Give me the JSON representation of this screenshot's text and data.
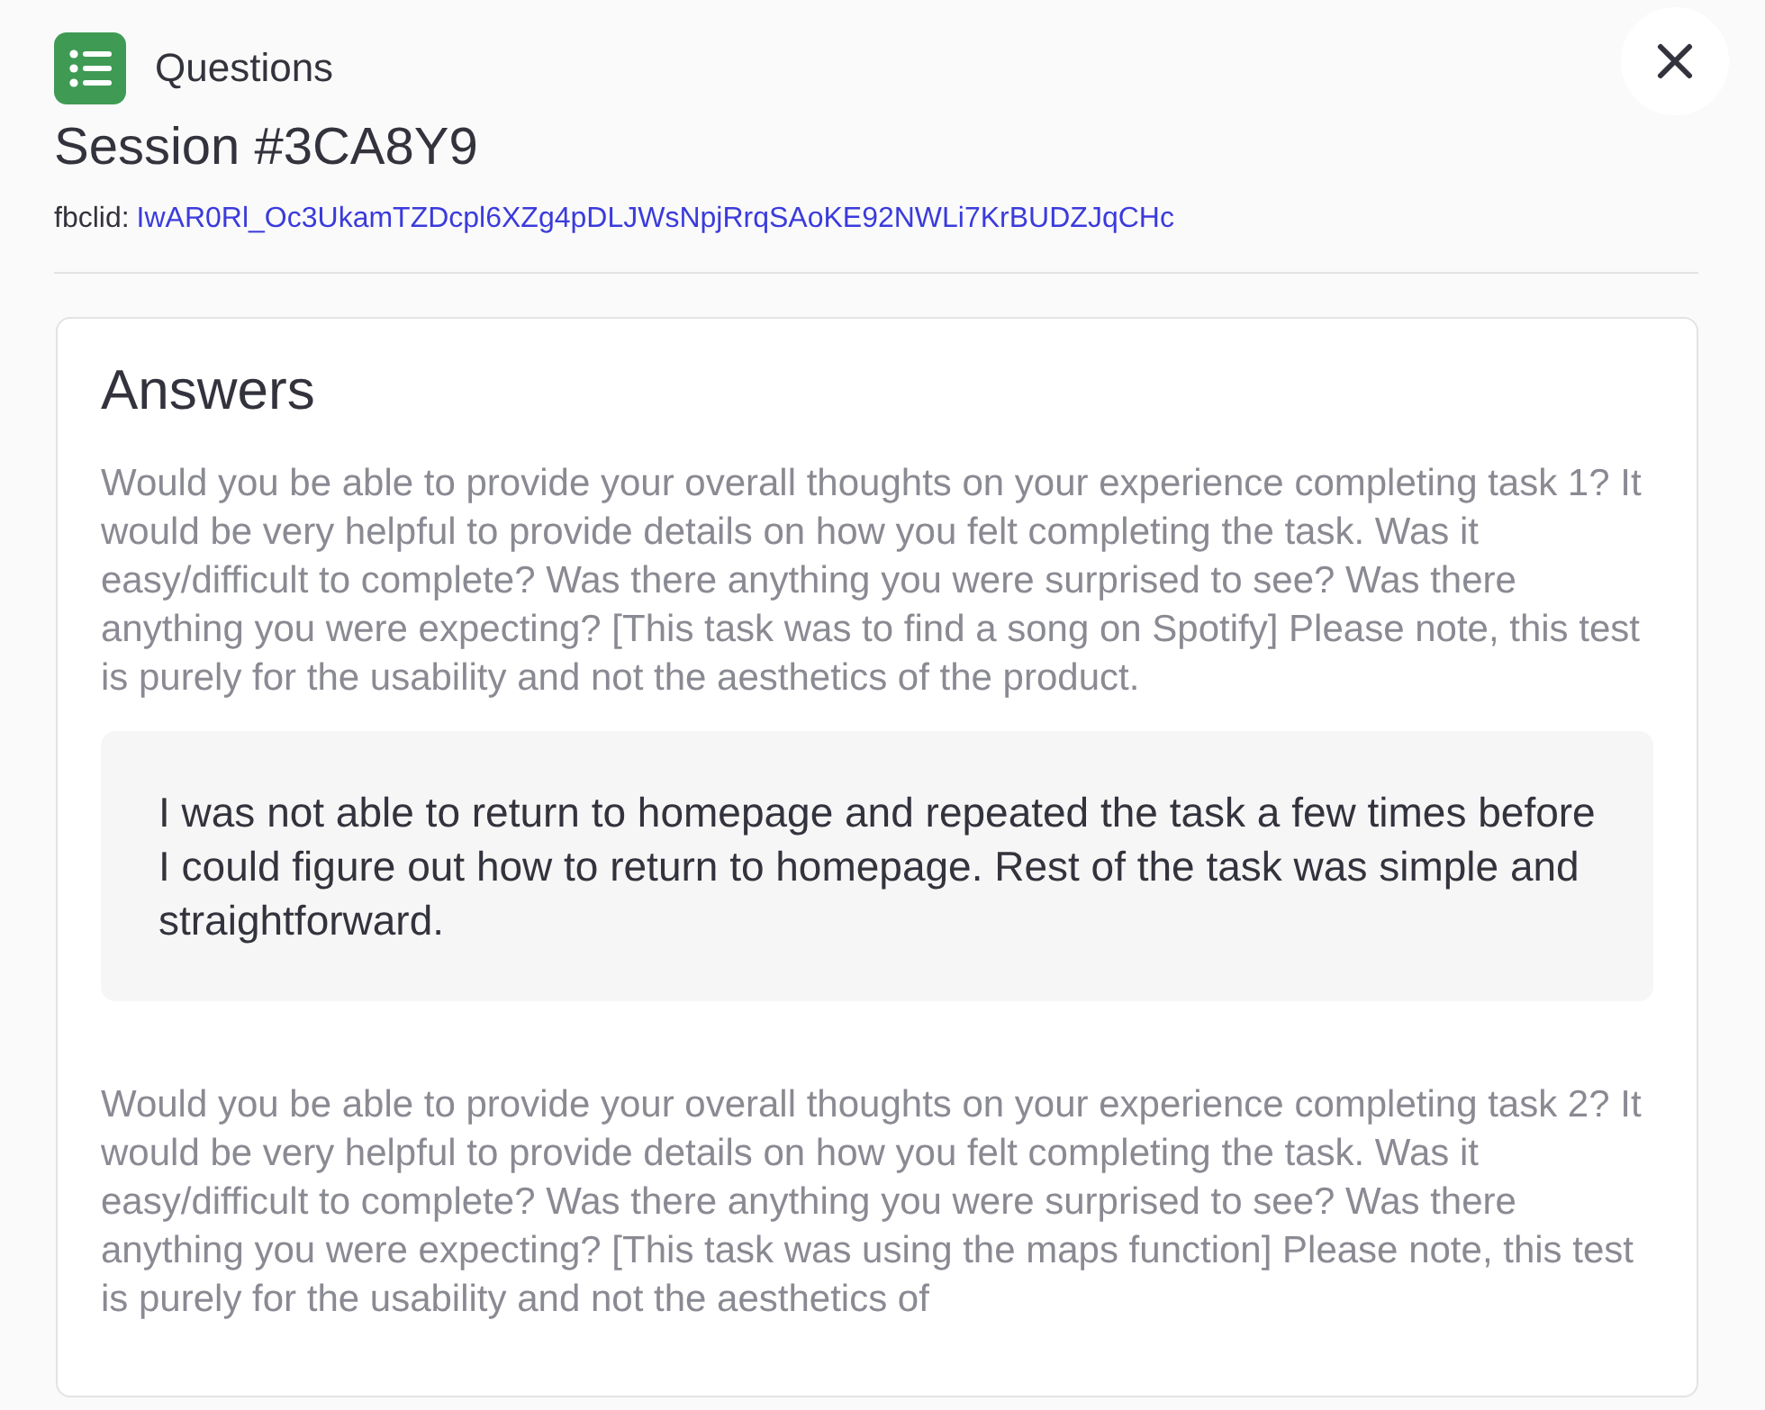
{
  "header": {
    "section": "Questions",
    "title": "Session #3CA8Y9",
    "param_label": "fbclid:",
    "param_value": "IwAR0Rl_Oc3UkamTZDcpl6XZg4pDLJWsNpjRrqSAoKE92NWLi7KrBUDZJqCHc"
  },
  "answers": {
    "title": "Answers",
    "items": [
      {
        "question": "Would you be able to provide your overall thoughts on your experience completing task 1? It would be very helpful to provide details on how you felt completing the task. Was it easy/difficult to complete? Was there anything you were surprised to see? Was there anything you were expecting? [This task was to find a song on Spotify] Please note, this test is purely for the usability and not the aesthetics of the product.",
        "answer": "I was not able to return to homepage and repeated the task a few times before I could figure out how to return to homepage. Rest of the task was simple and straightforward."
      },
      {
        "question": "Would you be able to provide your overall thoughts on your experience completing task 2? It would be very helpful to provide details on how you felt completing the task. Was it easy/difficult to complete? Was there anything you were surprised to see? Was there anything you were expecting? [This task was using the maps function] Please note, this test is purely for the usability and not the aesthetics of"
      }
    ]
  }
}
